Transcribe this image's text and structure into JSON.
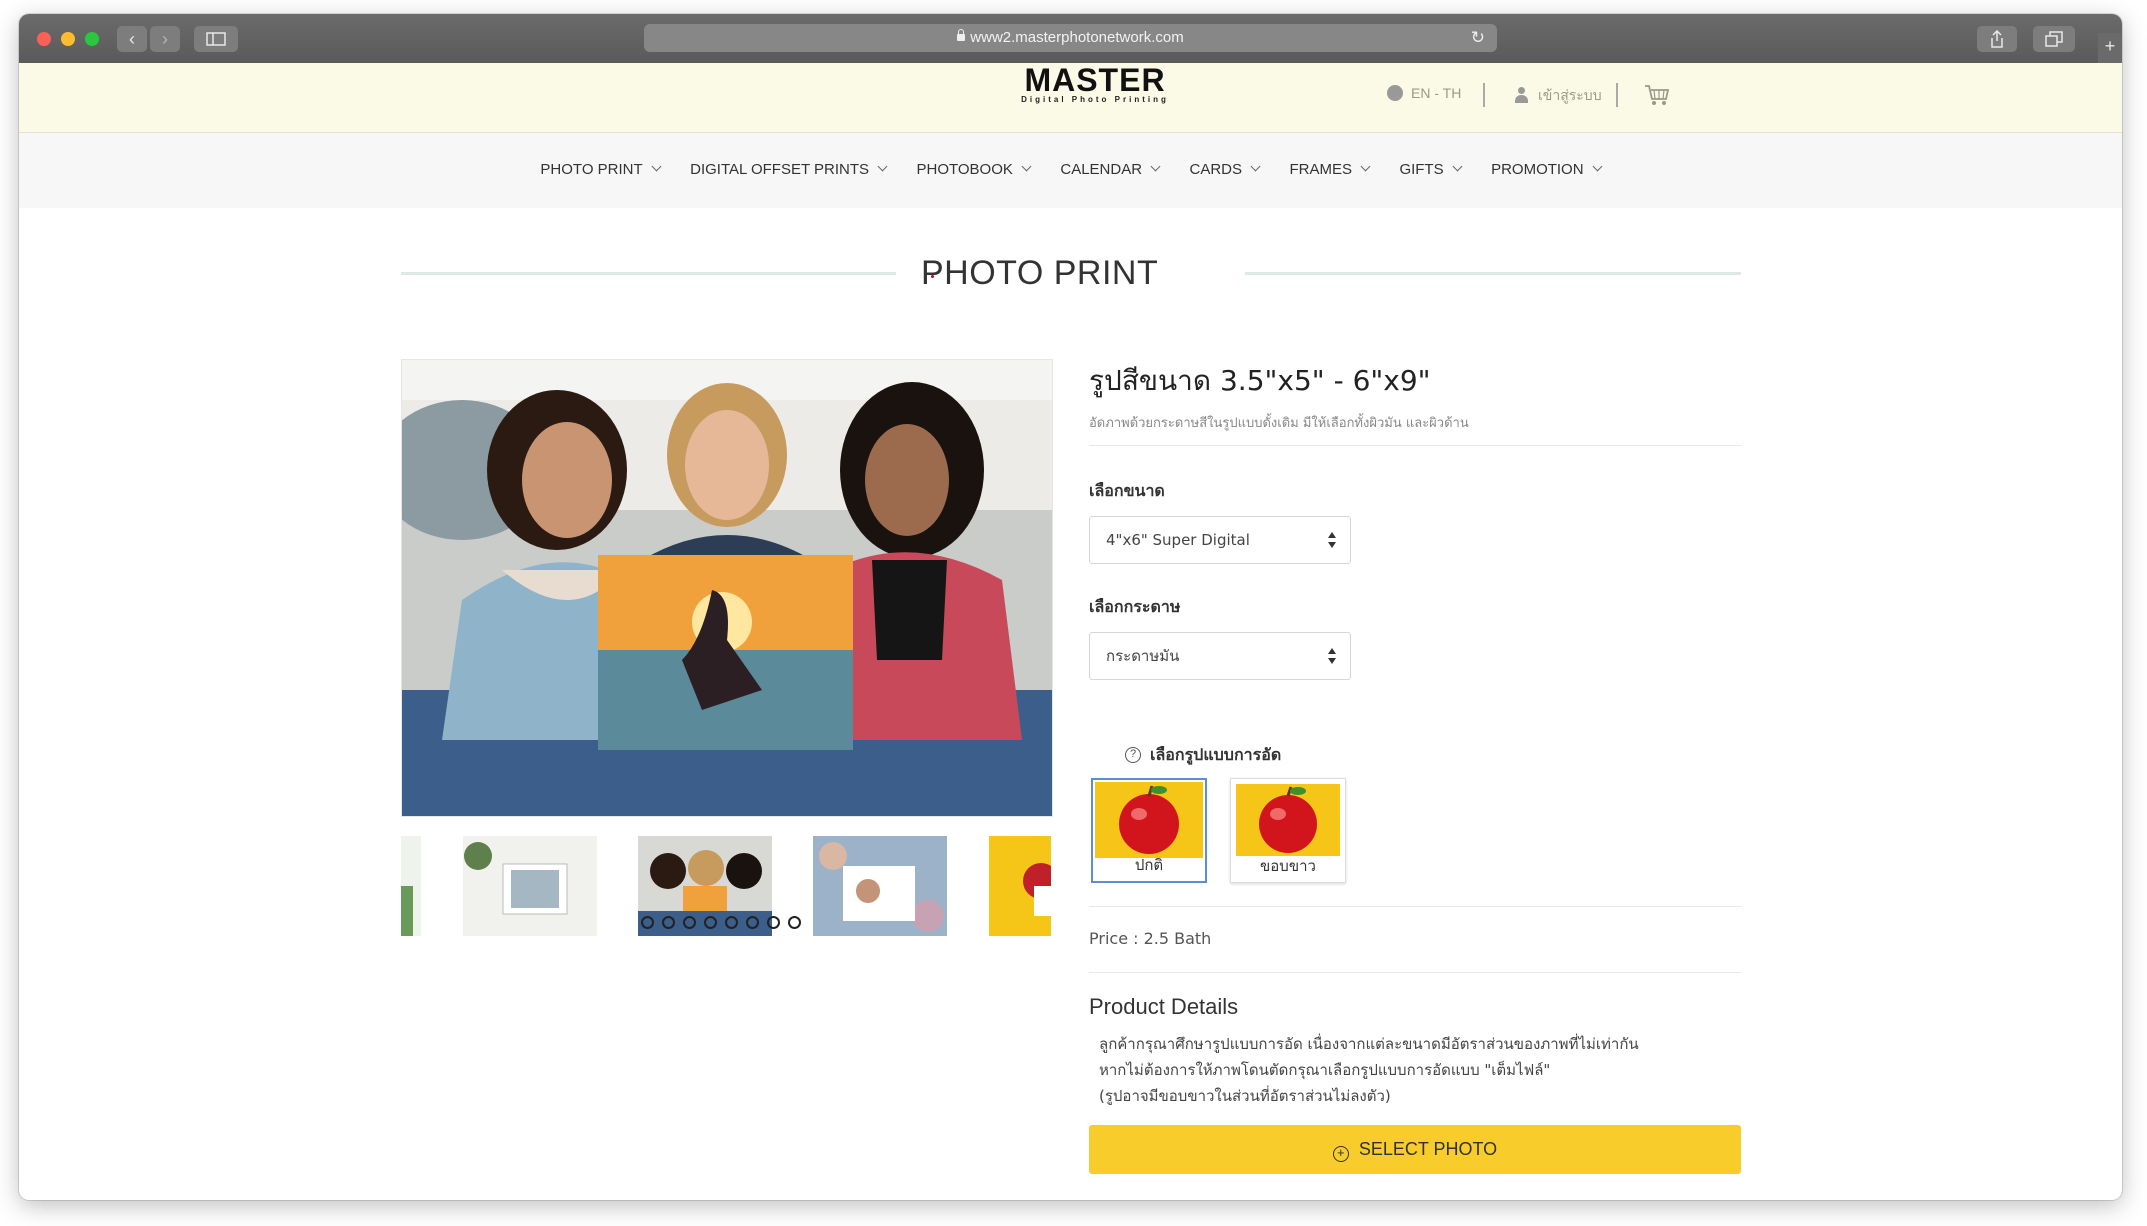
{
  "browser": {
    "url": "www2.masterphotonetwork.com"
  },
  "header": {
    "logo_main": "MASTER",
    "logo_sub": "Digital Photo Printing",
    "language": "EN - TH",
    "login": "เข้าสู่ระบบ"
  },
  "nav": {
    "items": [
      {
        "label": "PHOTO PRINT"
      },
      {
        "label": "DIGITAL OFFSET PRINTS"
      },
      {
        "label": "PHOTOBOOK"
      },
      {
        "label": "CALENDAR"
      },
      {
        "label": "CARDS"
      },
      {
        "label": "FRAMES"
      },
      {
        "label": "GIFTS"
      },
      {
        "label": "PROMOTION"
      }
    ]
  },
  "page": {
    "section_title": "PHOTO PRINT"
  },
  "product": {
    "title": "รูปสีขนาด 3.5\"x5\" - 6\"x9\"",
    "subtitle": "อัดภาพด้วยกระดาษสีในรูปแบบดั้งเดิม มีให้เลือกทั้งผิวมัน และผิวด้าน",
    "size_label": "เลือกขนาด",
    "size_value": "4\"x6\" Super Digital",
    "paper_label": "เลือกกระดาษ",
    "paper_value": "กระดาษมัน",
    "format_label": "เลือกรูปแบบการอัด",
    "format_options": [
      {
        "label": "ปกติ"
      },
      {
        "label": "ขอบขาว"
      }
    ],
    "price": "Price : 2.5 Bath",
    "details_title": "Product Details",
    "details_lines": [
      "ลูกค้ากรุณาศึกษารูปแบบการอัด เนื่องจากแต่ละขนาดมีอัตราส่วนของภาพที่ไม่เท่ากัน",
      "หากไม่ต้องการให้ภาพโดนตัดกรุณาเลือกรูปแบบการอัดแบบ \"เต็มไฟล์\"",
      "(รูปอาจมีขอบขาวในส่วนที่อัตราส่วนไม่ลงตัว)"
    ],
    "cta": "SELECT PHOTO"
  },
  "gallery": {
    "dot_count": 8
  },
  "colors": {
    "header_bg": "#fbfae6",
    "accent_yellow": "#f8cd2b",
    "selected_border": "#5c8fd0"
  }
}
